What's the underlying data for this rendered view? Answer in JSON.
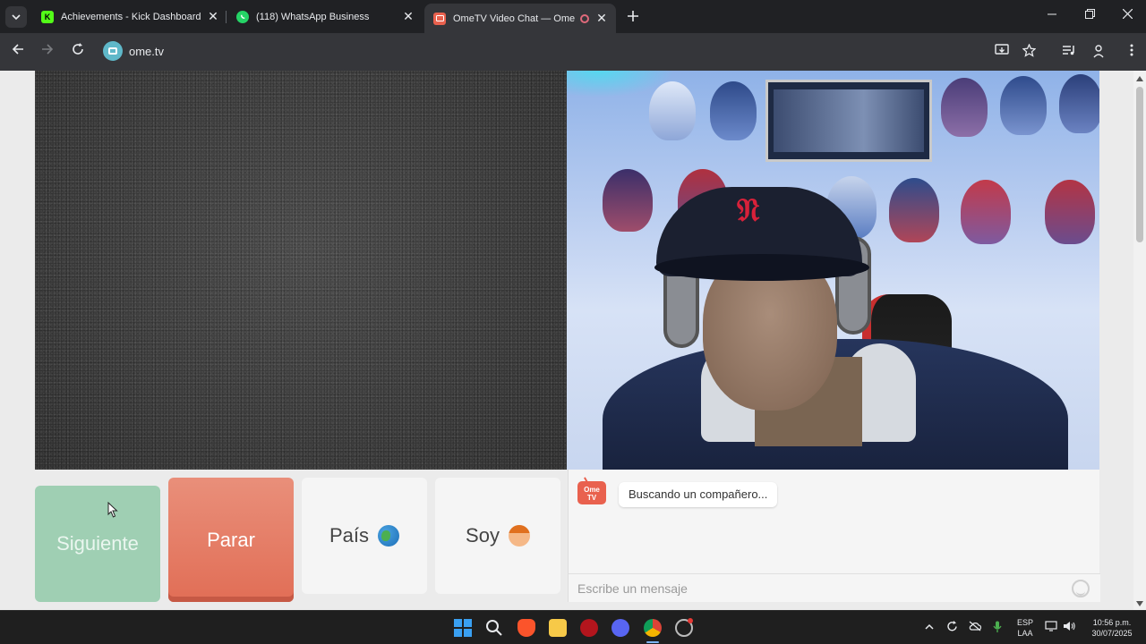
{
  "browser": {
    "tabs": [
      {
        "title": "Achievements - Kick Dashboard",
        "favicon": "kick-icon",
        "color": "#53fc18"
      },
      {
        "title": "(118) WhatsApp Business",
        "favicon": "whatsapp-icon",
        "color": "#25d366"
      },
      {
        "title": "OmeTV Video Chat — Omegle R",
        "favicon": "ometv-icon",
        "color": "#e9614e",
        "active": true
      }
    ],
    "url": "ome.tv"
  },
  "controls": {
    "next_label": "Siguiente",
    "stop_label": "Parar",
    "country_label": "País",
    "gender_label": "Soy"
  },
  "chat": {
    "logo_text_1": "Ome",
    "logo_text_2": "TV",
    "status_message": "Buscando un compañero...",
    "input_placeholder": "Escribe un mensaje"
  },
  "taskbar": {
    "language_1": "ESP",
    "language_2": "LAA",
    "time": "10:56 p.m.",
    "date": "30/07/2025"
  },
  "colors": {
    "next_button": "#9fcfb3",
    "stop_button": "#e16e56",
    "accent": "#e9614e"
  }
}
